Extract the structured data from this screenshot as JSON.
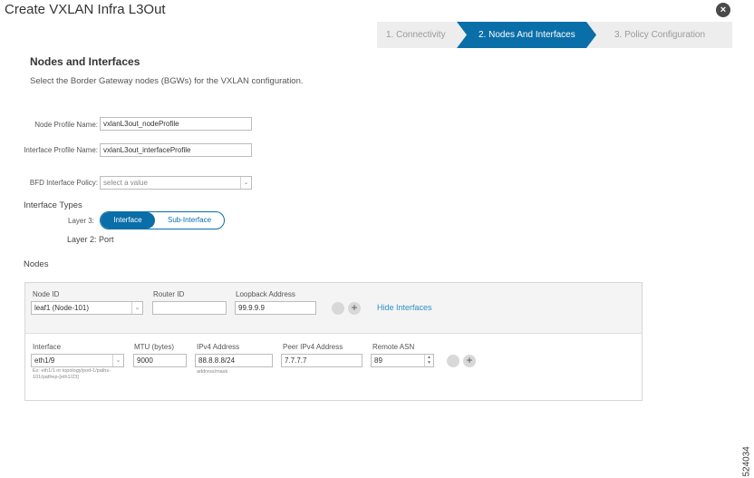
{
  "dialog": {
    "title": "Create VXLAN Infra L3Out",
    "close_label": "×"
  },
  "wizard": {
    "steps": [
      {
        "label": "1. Connectivity",
        "active": false
      },
      {
        "label": "2. Nodes And Interfaces",
        "active": true
      },
      {
        "label": "3. Policy Configuration",
        "active": false
      }
    ]
  },
  "section": {
    "title": "Nodes and Interfaces",
    "description": "Select the Border Gateway nodes (BGWs) for the VXLAN configuration."
  },
  "form": {
    "node_profile_label": "Node Profile Name:",
    "node_profile_value": "vxlanL3out_nodeProfile",
    "interface_profile_label": "Interface Profile Name:",
    "interface_profile_value": "vxlanL3out_interfaceProfile",
    "bfd_label": "BFD Interface Policy:",
    "bfd_placeholder": "select a value"
  },
  "interface_types": {
    "heading": "Interface Types",
    "layer3_label": "Layer 3:",
    "options": [
      "Interface",
      "Sub-Interface"
    ],
    "selected": "Interface",
    "layer2_label": "Layer 2: Port"
  },
  "nodes": {
    "heading": "Nodes",
    "node_id_label": "Node ID",
    "node_id_value": "leaf1 (Node-101)",
    "router_id_label": "Router ID",
    "router_id_value": "",
    "loopback_label": "Loopback Address",
    "loopback_value": "99.9.9.9",
    "hide_interfaces_label": "Hide Interfaces",
    "interface": {
      "interface_label": "Interface",
      "interface_value": "eth1/9",
      "interface_hint": "Ex: eth1/1 or topology/pod-1/paths-101/pathep-[eth1/23]",
      "mtu_label": "MTU (bytes)",
      "mtu_value": "9000",
      "ipv4_label": "IPv4 Address",
      "ipv4_value": "88.8.8.8/24",
      "ipv4_hint": "address/mask",
      "peer_label": "Peer IPv4 Address",
      "peer_value": "7.7.7.7",
      "asn_label": "Remote ASN",
      "asn_value": "89"
    }
  },
  "figure_number": "524034",
  "colors": {
    "accent": "#0a6ea8",
    "link": "#2d8fc9"
  }
}
